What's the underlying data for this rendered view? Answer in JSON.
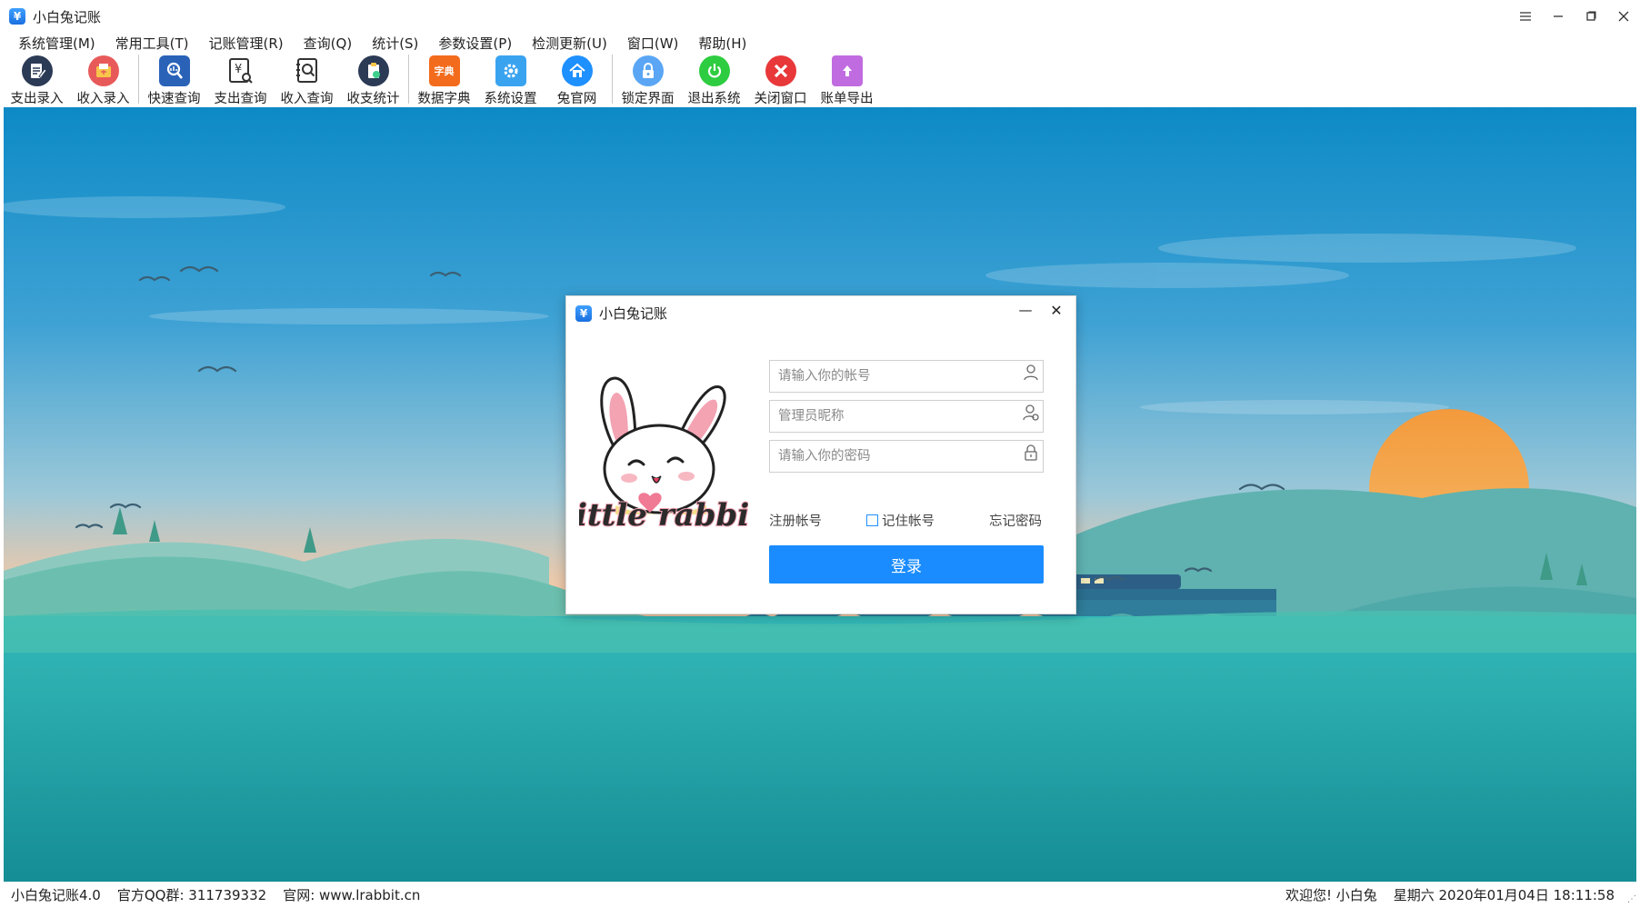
{
  "window": {
    "title": "小白兔记账",
    "app_icon_glyph": "¥",
    "controls": [
      "menu-icon",
      "minimize-icon",
      "maximize-icon",
      "close-icon"
    ]
  },
  "menubar": {
    "items": [
      {
        "label": "系统管理(M)"
      },
      {
        "label": "常用工具(T)"
      },
      {
        "label": "记账管理(R)"
      },
      {
        "label": "查询(Q)"
      },
      {
        "label": "统计(S)"
      },
      {
        "label": "参数设置(P)"
      },
      {
        "label": "检测更新(U)"
      },
      {
        "label": "窗口(W)"
      },
      {
        "label": "帮助(H)"
      }
    ]
  },
  "toolbar": {
    "buttons": [
      {
        "label": "支出录入",
        "icon": "expense-entry-icon",
        "color": "#2b3a55"
      },
      {
        "label": "收入录入",
        "icon": "income-entry-icon",
        "color": "#e85a5a"
      },
      {
        "label": "快速查询",
        "icon": "quick-search-icon",
        "color": "#2a62b8"
      },
      {
        "label": "支出查询",
        "icon": "expense-query-icon",
        "color": "#333333"
      },
      {
        "label": "收入查询",
        "icon": "income-query-icon",
        "color": "#333333"
      },
      {
        "label": "收支统计",
        "icon": "statistics-icon",
        "color": "#2b3a55"
      },
      {
        "label": "数据字典",
        "icon": "dictionary-icon",
        "color": "#f36b1c",
        "glyph": "字典"
      },
      {
        "label": "系统设置",
        "icon": "settings-icon",
        "color": "#3aa3f0"
      },
      {
        "label": "兔官网",
        "icon": "home-icon",
        "color": "#1e90ff"
      },
      {
        "label": "锁定界面",
        "icon": "lock-icon",
        "color": "#5aa6f5"
      },
      {
        "label": "退出系统",
        "icon": "power-icon",
        "color": "#2ecc40"
      },
      {
        "label": "关闭窗口",
        "icon": "close-window-icon",
        "color": "#e8383a"
      },
      {
        "label": "账单导出",
        "icon": "export-icon",
        "color": "#c06ce0"
      }
    ]
  },
  "login_dialog": {
    "title": "小白兔记账",
    "logo_text": "little rabbit",
    "account_placeholder": "请输入你的帐号",
    "nickname_placeholder": "管理员昵称",
    "password_placeholder": "请输入你的密码",
    "register_label": "注册帐号",
    "remember_label": "记住帐号",
    "remember_checked": false,
    "forgot_label": "忘记密码",
    "login_label": "登录",
    "accent_color": "#1a8cff"
  },
  "statusbar": {
    "version": "小白兔记账4.0",
    "qq_group": "官方QQ群:  311739332",
    "website": "官网:  www.lrabbit.cn",
    "welcome": "欢迎您!  小白兔",
    "datetime": "星期六 2020年01月04日 18:11:58"
  }
}
